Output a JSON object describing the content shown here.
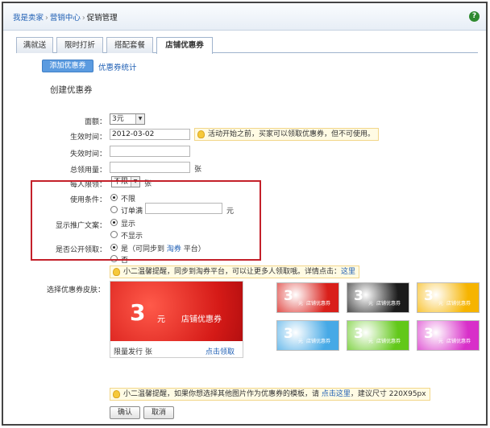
{
  "breadcrumb": {
    "home": "我是卖家",
    "center": "营销中心",
    "current": "促销管理"
  },
  "tabs": [
    "满就送",
    "限时打折",
    "搭配套餐",
    "店铺优惠券"
  ],
  "subnav": {
    "add_button": "添加优惠券",
    "stats_link": "优惠券统计"
  },
  "section_title": "创建优惠券",
  "form": {
    "denomination": {
      "label": "面额：",
      "value": "3元"
    },
    "start": {
      "label": "生效时间：",
      "value": "2012-03-02",
      "tip": "活动开始之前，买家可以领取优惠券，但不可使用。"
    },
    "end": {
      "label": "失效时间：",
      "value": ""
    },
    "total": {
      "label": "总领用量：",
      "value": "",
      "unit": "张"
    },
    "per_person": {
      "label": "每人限领：",
      "value": "不限",
      "unit": "张"
    },
    "condition": {
      "label": "使用条件：",
      "opt_unlimited": "不限",
      "opt_order": "订单满",
      "order_value": "",
      "unit": "元"
    },
    "promo_text": {
      "label": "显示推广文案：",
      "opt_show": "显示",
      "opt_hide": "不显示"
    },
    "public_claim": {
      "label": "是否公开领取：",
      "opt_yes_prefix": "是（可同步到 ",
      "opt_yes_link": "淘券",
      "opt_yes_suffix": " 平台）",
      "opt_no": "否"
    },
    "tip2": {
      "text": "小二温馨提醒，同步到淘券平台，可以让更多人领取哦。详情点击：",
      "link": "这里"
    },
    "skin": {
      "label": "选择优惠券皮肤："
    },
    "tip3": {
      "prefix": "小二温馨提醒，如果你想选择其他图片作为优惠券的模板，请 ",
      "link": "点击这里",
      "suffix": "，建议尺寸 220X95px"
    }
  },
  "preview": {
    "amount": "3",
    "unit": "元",
    "name": "店铺优惠券",
    "footer": "限量发行 张",
    "claim_link": "点击领取"
  },
  "skins": [
    {
      "amount": "3",
      "unit": "元",
      "name": "店铺优惠券",
      "color": "#d91f1a"
    },
    {
      "amount": "3",
      "unit": "元",
      "name": "店铺优惠券",
      "color": "#1b1b1b"
    },
    {
      "amount": "3",
      "unit": "元",
      "name": "店铺优惠券",
      "color": "#f6b400"
    },
    {
      "amount": "3",
      "unit": "元",
      "name": "店铺优惠券",
      "color": "#46a9e6"
    },
    {
      "amount": "3",
      "unit": "元",
      "name": "店铺优惠券",
      "color": "#62c81a"
    },
    {
      "amount": "3",
      "unit": "元",
      "name": "店铺优惠券",
      "color": "#d82fc9"
    }
  ],
  "buttons": {
    "confirm": "确认",
    "cancel": "取消"
  },
  "colors": {
    "accent": "#5b9be0",
    "link": "#1f5fb4",
    "highlight_box": "#c4202a"
  }
}
